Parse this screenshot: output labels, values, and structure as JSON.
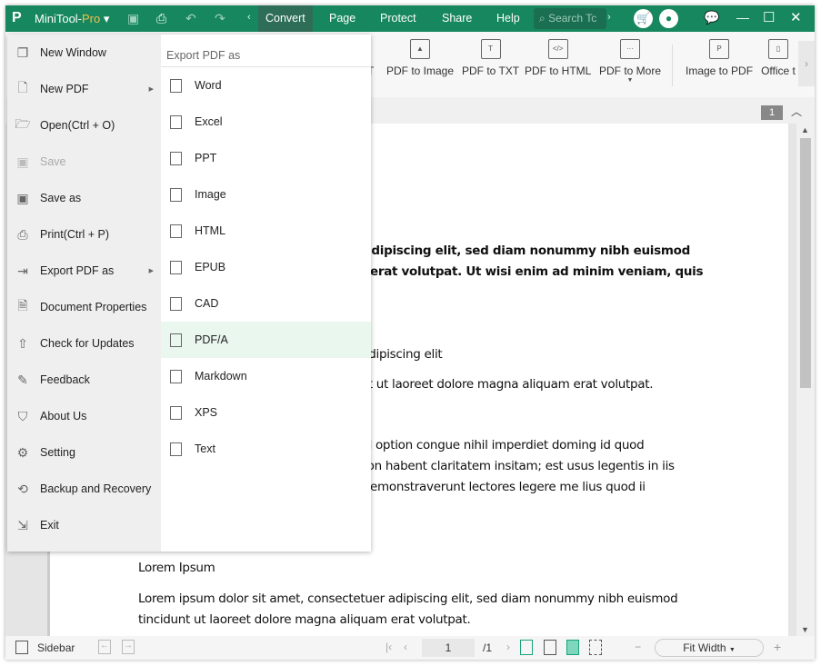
{
  "app": {
    "name": "MiniTool-",
    "edition": "Pro",
    "accent": "#17875f"
  },
  "titlebar": {
    "tabs": [
      "Convert",
      "Page",
      "Protect",
      "Share",
      "Help"
    ],
    "active_tab": "Convert",
    "search_placeholder": "Search Tc"
  },
  "ribbon": {
    "items": [
      "T",
      "PDF to Image",
      "PDF to TXT",
      "PDF to HTML",
      "PDF to More",
      "Image to PDF",
      "Office t"
    ]
  },
  "page_badge": "1",
  "file_menu": {
    "items": [
      {
        "label": "New Window",
        "icon": "new-window-icon"
      },
      {
        "label": "New PDF",
        "icon": "new-pdf-icon",
        "submenu": true
      },
      {
        "label": "Open(Ctrl + O)",
        "icon": "folder-icon"
      },
      {
        "label": "Save",
        "icon": "save-icon",
        "disabled": true
      },
      {
        "label": "Save as",
        "icon": "save-as-icon"
      },
      {
        "label": "Print(Ctrl + P)",
        "icon": "print-icon"
      },
      {
        "label": "Export PDF as",
        "icon": "export-icon",
        "submenu": true
      },
      {
        "label": "Document Properties",
        "icon": "document-icon"
      },
      {
        "label": "Check for Updates",
        "icon": "update-icon"
      },
      {
        "label": "Feedback",
        "icon": "feedback-icon"
      },
      {
        "label": "About Us",
        "icon": "bookmark-icon"
      },
      {
        "label": "Setting",
        "icon": "gear-icon"
      },
      {
        "label": "Backup and Recovery",
        "icon": "backup-icon"
      },
      {
        "label": "Exit",
        "icon": "exit-icon"
      }
    ]
  },
  "export_menu": {
    "heading": "Export PDF as",
    "items": [
      "Word",
      "Excel",
      "PPT",
      "Image",
      "HTML",
      "EPUB",
      "CAD",
      "PDF/A",
      "Markdown",
      "XPS",
      "Text"
    ],
    "highlighted": "PDF/A"
  },
  "document": {
    "lines": [
      {
        "text": "er adipiscing elit, sed diam nonummy nibh euismod",
        "bold": true
      },
      {
        "text": "am erat volutpat. Ut wisi enim ad minim veniam, quis",
        "bold": true
      },
      {
        "text": "er adipiscing elit"
      },
      {
        "text": "dunt ut laoreet dolore magna aliquam erat volutpat."
      },
      {
        "text": "fend option congue nihil imperdiet doming id quod"
      },
      {
        "text": "oi non habent claritatem insitam; est usus legentis in iis"
      },
      {
        "text": "es demonstraverunt lectores legere me lius quod ii"
      },
      {
        "text": "Lorem Ipsum"
      },
      {
        "text": "Lorem ipsum dolor sit amet, consectetuer adipiscing elit, sed diam nonummy nibh euismod"
      },
      {
        "text": "tincidunt ut laoreet dolore magna aliquam erat volutpat."
      }
    ]
  },
  "statusbar": {
    "sidebar_label": "Sidebar",
    "current_page": "1",
    "total_pages": "/1",
    "zoom": "Fit Width"
  }
}
